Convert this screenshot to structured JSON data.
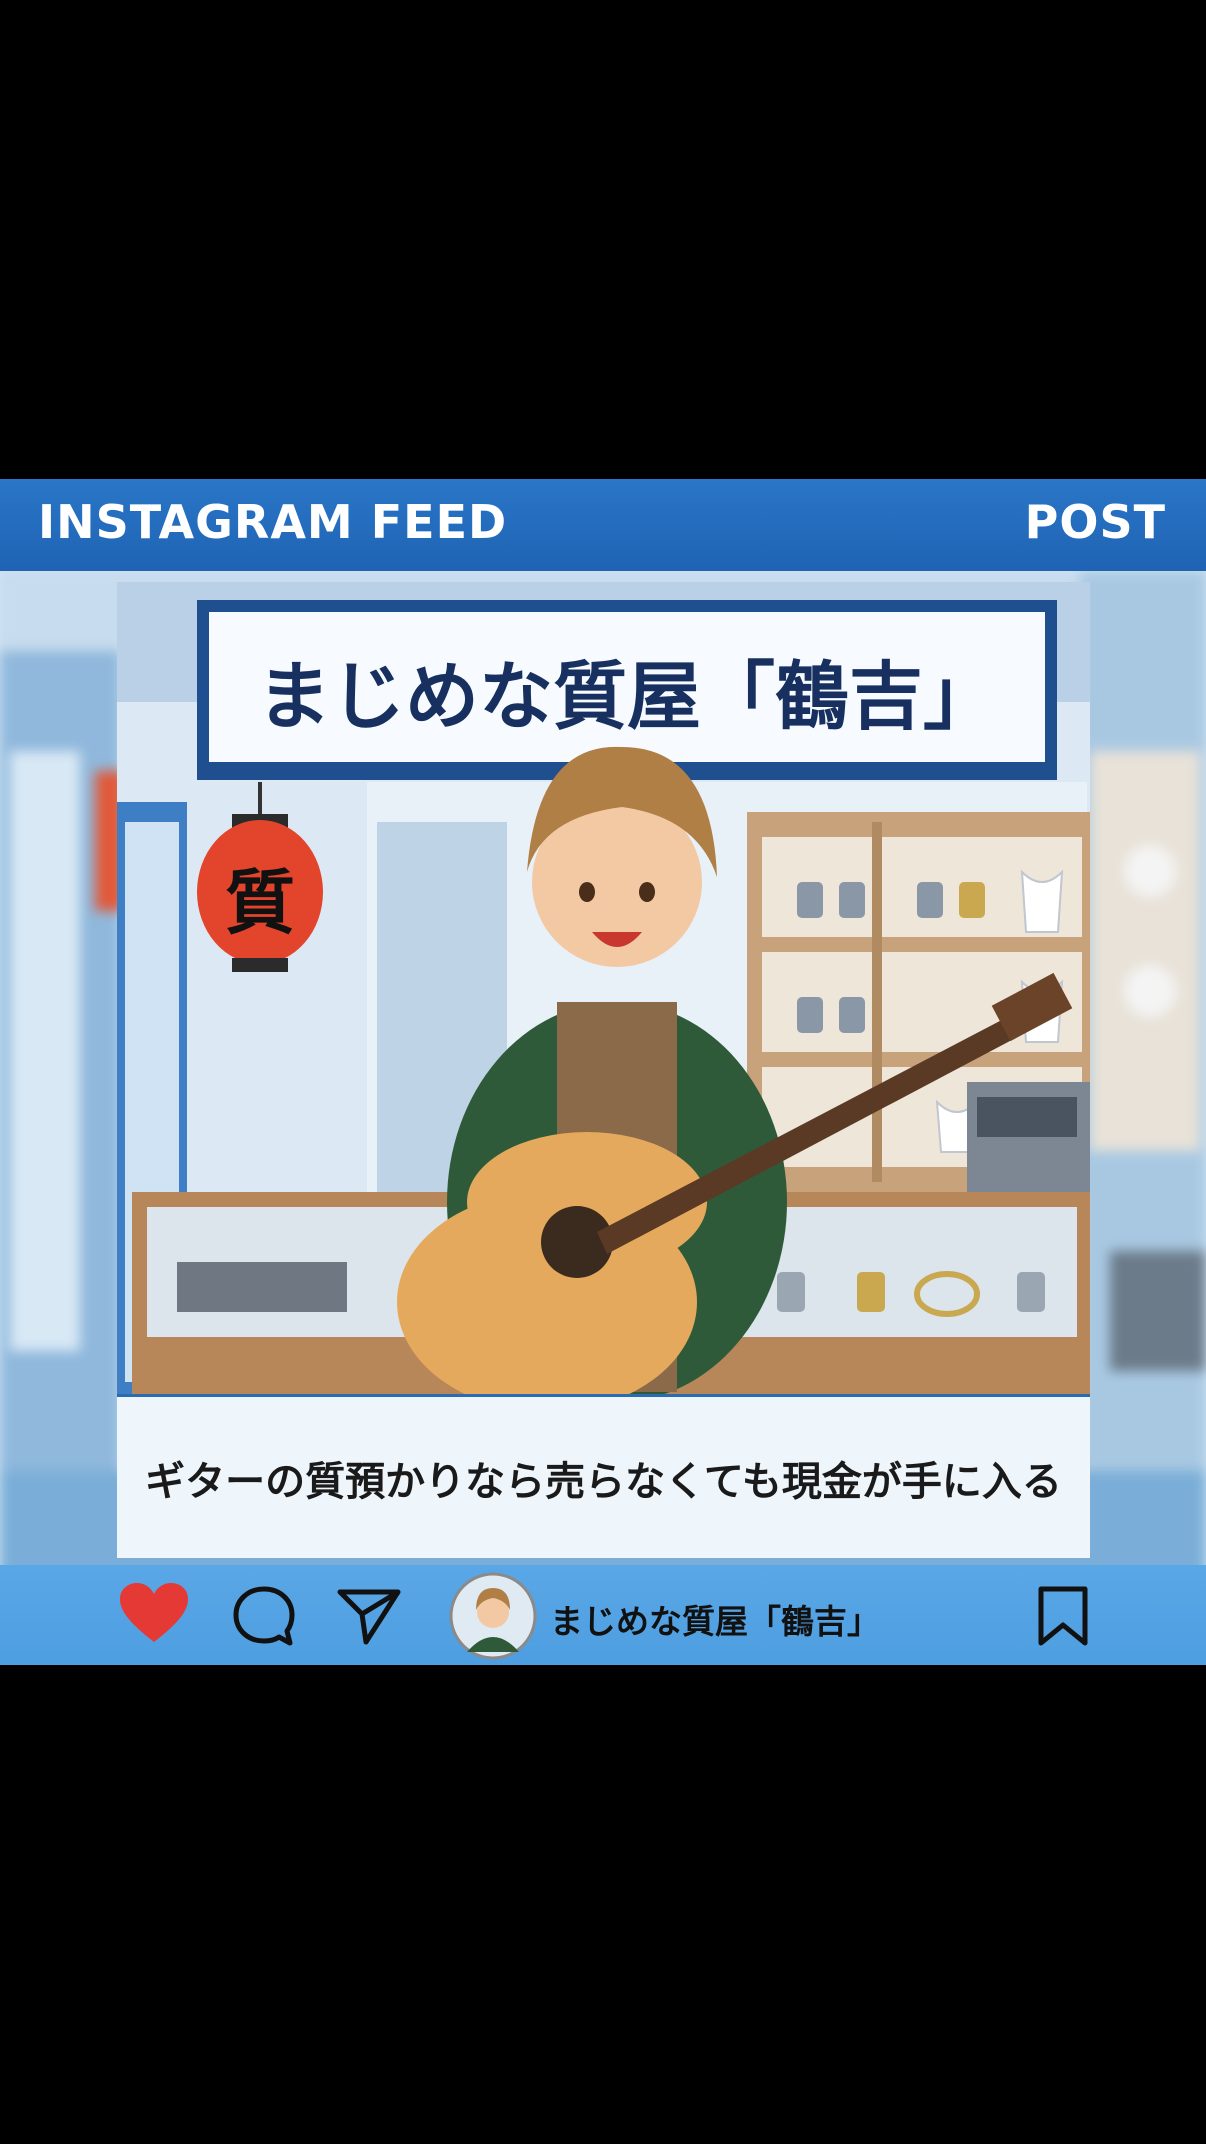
{
  "header": {
    "left_label": "INSTAGRAM FEED",
    "right_label": "POST"
  },
  "post": {
    "sign_text": "まじめな質屋「鶴吉」",
    "lantern_char": "質",
    "caption": "ギターの質預かりなら売らなくても現金が手に入る"
  },
  "actions": {
    "like_icon": "heart-icon",
    "comment_icon": "comment-bubble-icon",
    "share_icon": "send-icon",
    "save_icon": "bookmark-icon",
    "account_name": "まじめな質屋「鶴吉」"
  },
  "colors": {
    "brand_blue": "#1f63b4",
    "like_red": "#e53935",
    "action_bar": "#55a3e4"
  }
}
